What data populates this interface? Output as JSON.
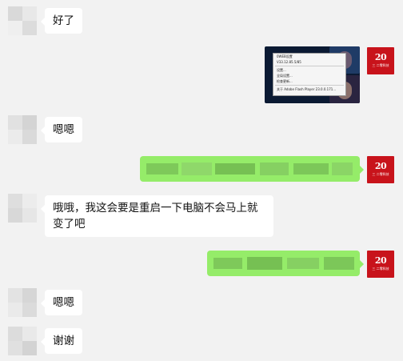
{
  "colors": {
    "background": "#f2f2f2",
    "bubble_incoming": "#ffffff",
    "bubble_outgoing": "#95ec69",
    "self_avatar": "#c8131b"
  },
  "self_avatar": {
    "number": "20",
    "caption": "三 二零科技"
  },
  "messages": [
    {
      "side": "left",
      "text": "好了"
    },
    {
      "side": "right",
      "type": "image",
      "context_menu": [
        "0WEB设置",
        "V33.12.85.5/85",
        "设置...",
        "全局设置...",
        "检查更新...",
        "关于 Adobe Flash Player 23.0.0.171..."
      ]
    },
    {
      "side": "left",
      "text": "嗯嗯"
    },
    {
      "side": "right",
      "type": "blurred"
    },
    {
      "side": "left",
      "text": "哦哦，我这会要是重启一下电脑不会马上就变了吧"
    },
    {
      "side": "right",
      "type": "blurred"
    },
    {
      "side": "left",
      "text": "嗯嗯"
    },
    {
      "side": "left",
      "text": "谢谢"
    }
  ]
}
